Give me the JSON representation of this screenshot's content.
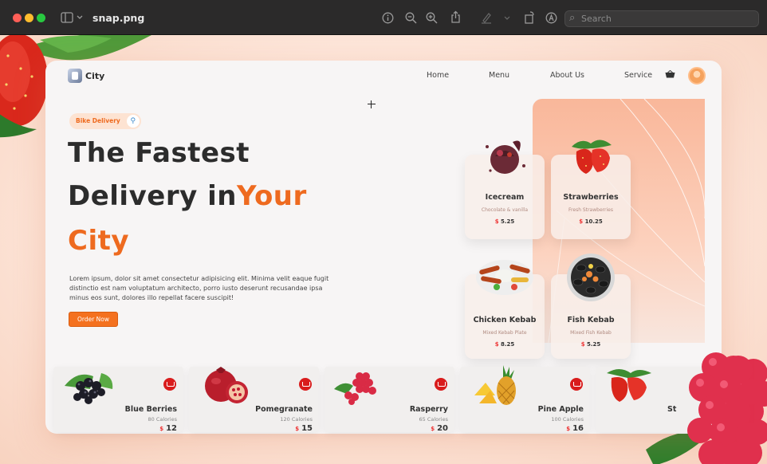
{
  "window": {
    "title": "snap.png",
    "search_placeholder": "Search",
    "toolbar_icons": [
      "sidebar-icon",
      "chevron-down-icon",
      "info-icon",
      "zoom-out-icon",
      "zoom-in-icon",
      "share-icon",
      "highlight-icon",
      "rotate-icon",
      "markup-icon",
      "search-icon"
    ]
  },
  "site": {
    "brand": "City",
    "nav": [
      "Home",
      "Menu",
      "About Us",
      "Service"
    ],
    "badge": "Bike Delivery",
    "hero": {
      "line1": "The Fastest",
      "line2a": "Delivery in",
      "line2b": "Your",
      "line3": "City",
      "paragraph": "Lorem ipsum, dolor sit amet consectetur adipisicing elit. Minima velit eaque fugit distinctio est nam voluptatum architecto, porro iusto deserunt recusandae ipsa minus eos sunt, dolores illo repellat facere suscipit!",
      "button": "Order Now"
    },
    "products": [
      {
        "name": "Icecream",
        "sub": "Chocolate & vanilla",
        "currency": "$",
        "price": "5.25",
        "icon": "icecream-icon"
      },
      {
        "name": "Strawberries",
        "sub": "Fresh Strawberries",
        "currency": "$",
        "price": "10.25",
        "icon": "strawberry-icon"
      },
      {
        "name": "Chicken Kebab",
        "sub": "Mixed Kebab Plate",
        "currency": "$",
        "price": "8.25",
        "icon": "kebab-plate-icon"
      },
      {
        "name": "Fish Kebab",
        "sub": "Mixed Fish Kebab",
        "currency": "$",
        "price": "5.25",
        "icon": "seafood-plate-icon"
      }
    ],
    "fruits": [
      {
        "name": "Blue Berries",
        "calories": "80 Calories",
        "currency": "$",
        "price": "12"
      },
      {
        "name": "Pomegranate",
        "calories": "120 Calories",
        "currency": "$",
        "price": "15"
      },
      {
        "name": "Rasperry",
        "calories": "65 Calories",
        "currency": "$",
        "price": "20"
      },
      {
        "name": "Pine Apple",
        "calories": "100 Calories",
        "currency": "$",
        "price": "16"
      },
      {
        "name": "St",
        "calories": "",
        "currency": "",
        "price": ""
      }
    ]
  },
  "colors": {
    "accent": "#ee6a1f",
    "button": "#f4711f",
    "cart_badge": "#d91c1c",
    "panel_gradient_top": "#f9b79a"
  }
}
